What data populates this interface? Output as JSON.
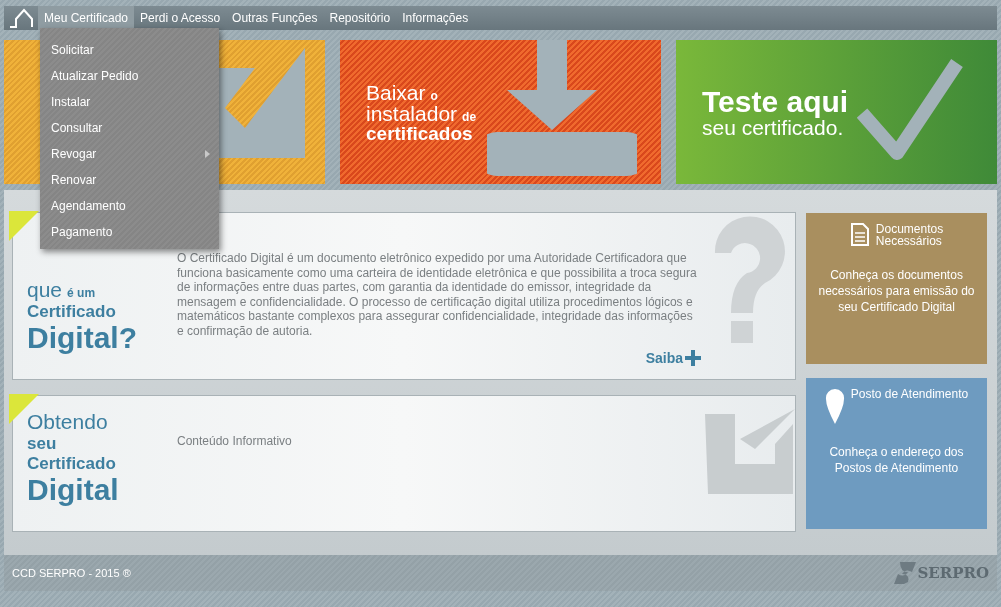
{
  "nav": {
    "items": [
      {
        "label": "Meu Certificado",
        "selected": true
      },
      {
        "label": "Perdi o Acesso",
        "selected": false
      },
      {
        "label": "Outras Funções",
        "selected": false
      },
      {
        "label": "Repositório",
        "selected": false
      },
      {
        "label": "Informações",
        "selected": false
      }
    ]
  },
  "dropdown": {
    "items": [
      {
        "label": "Solicitar",
        "has_submenu": false
      },
      {
        "label": "Atualizar Pedido",
        "has_submenu": false
      },
      {
        "label": "Instalar",
        "has_submenu": false
      },
      {
        "label": "Consultar",
        "has_submenu": false
      },
      {
        "label": "Revogar",
        "has_submenu": true
      },
      {
        "label": "Renovar",
        "has_submenu": false
      },
      {
        "label": "Agendamento",
        "has_submenu": false
      },
      {
        "label": "Pagamento",
        "has_submenu": false
      }
    ]
  },
  "banners": [
    {
      "kind": "request"
    },
    {
      "kind": "download",
      "lines": [
        [
          "Baixar",
          "o"
        ],
        [
          "instalador",
          "de"
        ],
        [
          "certificados"
        ]
      ]
    },
    {
      "kind": "test",
      "lines": [
        [
          "Teste aqui"
        ],
        [
          "seu certificado."
        ]
      ]
    }
  ],
  "info_cards": [
    {
      "kind": "question",
      "heading": [
        [
          "que",
          "é um"
        ],
        [
          "Certificado"
        ],
        [
          "Digital?"
        ]
      ],
      "body": "O Certificado Digital é um documento eletrônico expedido por uma Autoridade Certificadora que funciona basicamente como uma carteira de identidade eletrônica e que possibilita a troca segura de informações entre duas partes, com garantia da identidade do emissor, integridade da mensagem e confidencialidade. O processo de certificação digital utiliza procedimentos lógicos e matemáticos bastante complexos para assegurar confidencialidade, integridade das informações e confirmação de autoria.",
      "link": "Saiba"
    },
    {
      "kind": "check",
      "heading": [
        [
          "Obtendo"
        ],
        [
          "seu"
        ],
        [
          "Certificado"
        ],
        [
          "Digital"
        ]
      ],
      "body": "Conteúdo Informativo"
    }
  ],
  "side_tiles": [
    {
      "kind": "documents",
      "color": "#a98f5f",
      "title": [
        "Documentos",
        "Necessários"
      ],
      "body": "Conheça os documentos necessários para emissão do seu Certificado Digital"
    },
    {
      "kind": "location",
      "color": "#6e9bc0",
      "title": [
        "Posto de Atendimento"
      ],
      "body": "Conheça o endereço dos Postos de Atendimento"
    }
  ],
  "footer": {
    "copyright": "CCD SERPRO - 2015 ®",
    "logo": "SERPRO"
  }
}
